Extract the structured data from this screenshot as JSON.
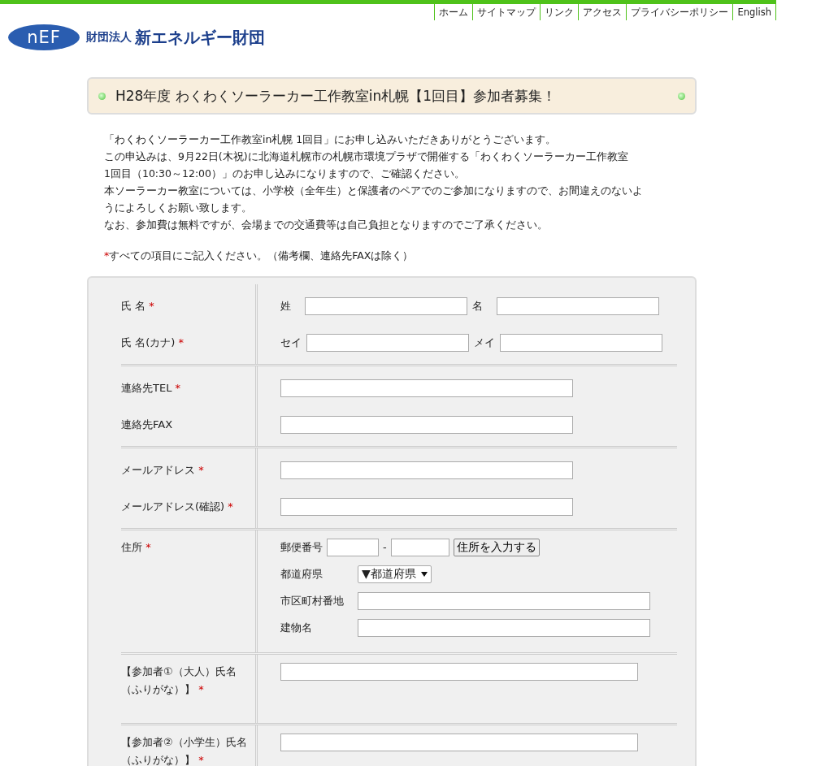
{
  "header": {
    "nav": [
      "ホーム",
      "サイトマップ",
      "リンク",
      "アクセス",
      "プライバシーポリシー",
      "English"
    ],
    "logo_text": "nEF",
    "org_prefix": "財団法人",
    "org_name": "新エネルギー財団"
  },
  "title": "H28年度 わくわくソーラーカー工作教室in札幌【1回目】参加者募集！",
  "intro_lines": [
    "「わくわくソーラーカー工作教室in札幌 1回目」にお申し込みいただきありがとうございます。",
    "この申込みは、9月22日(木祝)に北海道札幌市の札幌市環境プラザで開催する「わくわくソーラーカー工作教室",
    "1回目（10:30～12:00）」のお申し込みになりますので、ご確認ください。",
    "本ソーラーカー教室については、小学校（全年生）と保護者のペアでのご参加になりますので、お間違えのないよ",
    "うによろしくお願い致します。",
    "なお、参加費は無料ですが、会場までの交通費等は自己負担となりますのでご了承ください。"
  ],
  "required_note": {
    "mark": "*",
    "text": "すべての項目にご記入ください。（備考欄、連絡先FAXは除く）"
  },
  "form_sections": [
    {
      "rows": [
        {
          "kind": "pair",
          "label_lines": [
            "氏 名"
          ],
          "mark": "*",
          "fields": [
            {
              "label": "姓"
            },
            {
              "label": "名"
            }
          ]
        },
        {
          "kind": "pair",
          "label_lines": [
            "氏 名(カナ)"
          ],
          "mark": "*",
          "fields": [
            {
              "label": "セイ"
            },
            {
              "label": "メイ"
            }
          ]
        }
      ]
    },
    {
      "rows": [
        {
          "kind": "text",
          "label_lines": [
            "連絡先TEL"
          ],
          "mark": "*"
        },
        {
          "kind": "text",
          "label_lines": [
            "連絡先FAX"
          ]
        }
      ]
    },
    {
      "rows": [
        {
          "kind": "text",
          "label_lines": [
            "メールアドレス"
          ],
          "mark": "*"
        },
        {
          "kind": "text",
          "label_lines": [
            "メールアドレス(確認)"
          ],
          "mark": "*"
        }
      ]
    },
    {
      "rows": [
        {
          "kind": "address",
          "label_lines": [
            "住所"
          ],
          "mark": "*",
          "postal_label": "郵便番号",
          "postal_separator": "-",
          "lookup_button": "住所を入力する",
          "prefecture_label": "都道府県",
          "prefecture_select": "▼都道府県",
          "city_label": "市区町村番地",
          "building_label": "建物名"
        }
      ]
    },
    {
      "rows": [
        {
          "kind": "wide",
          "label_lines": [
            "【参加者①（大人）氏名",
            "（ふりがな）】"
          ],
          "mark": "*"
        }
      ]
    },
    {
      "rows": [
        {
          "kind": "wide",
          "label_lines": [
            "【参加者②（小学生）氏名",
            "（ふりがな）】"
          ],
          "mark": "*"
        }
      ]
    }
  ]
}
